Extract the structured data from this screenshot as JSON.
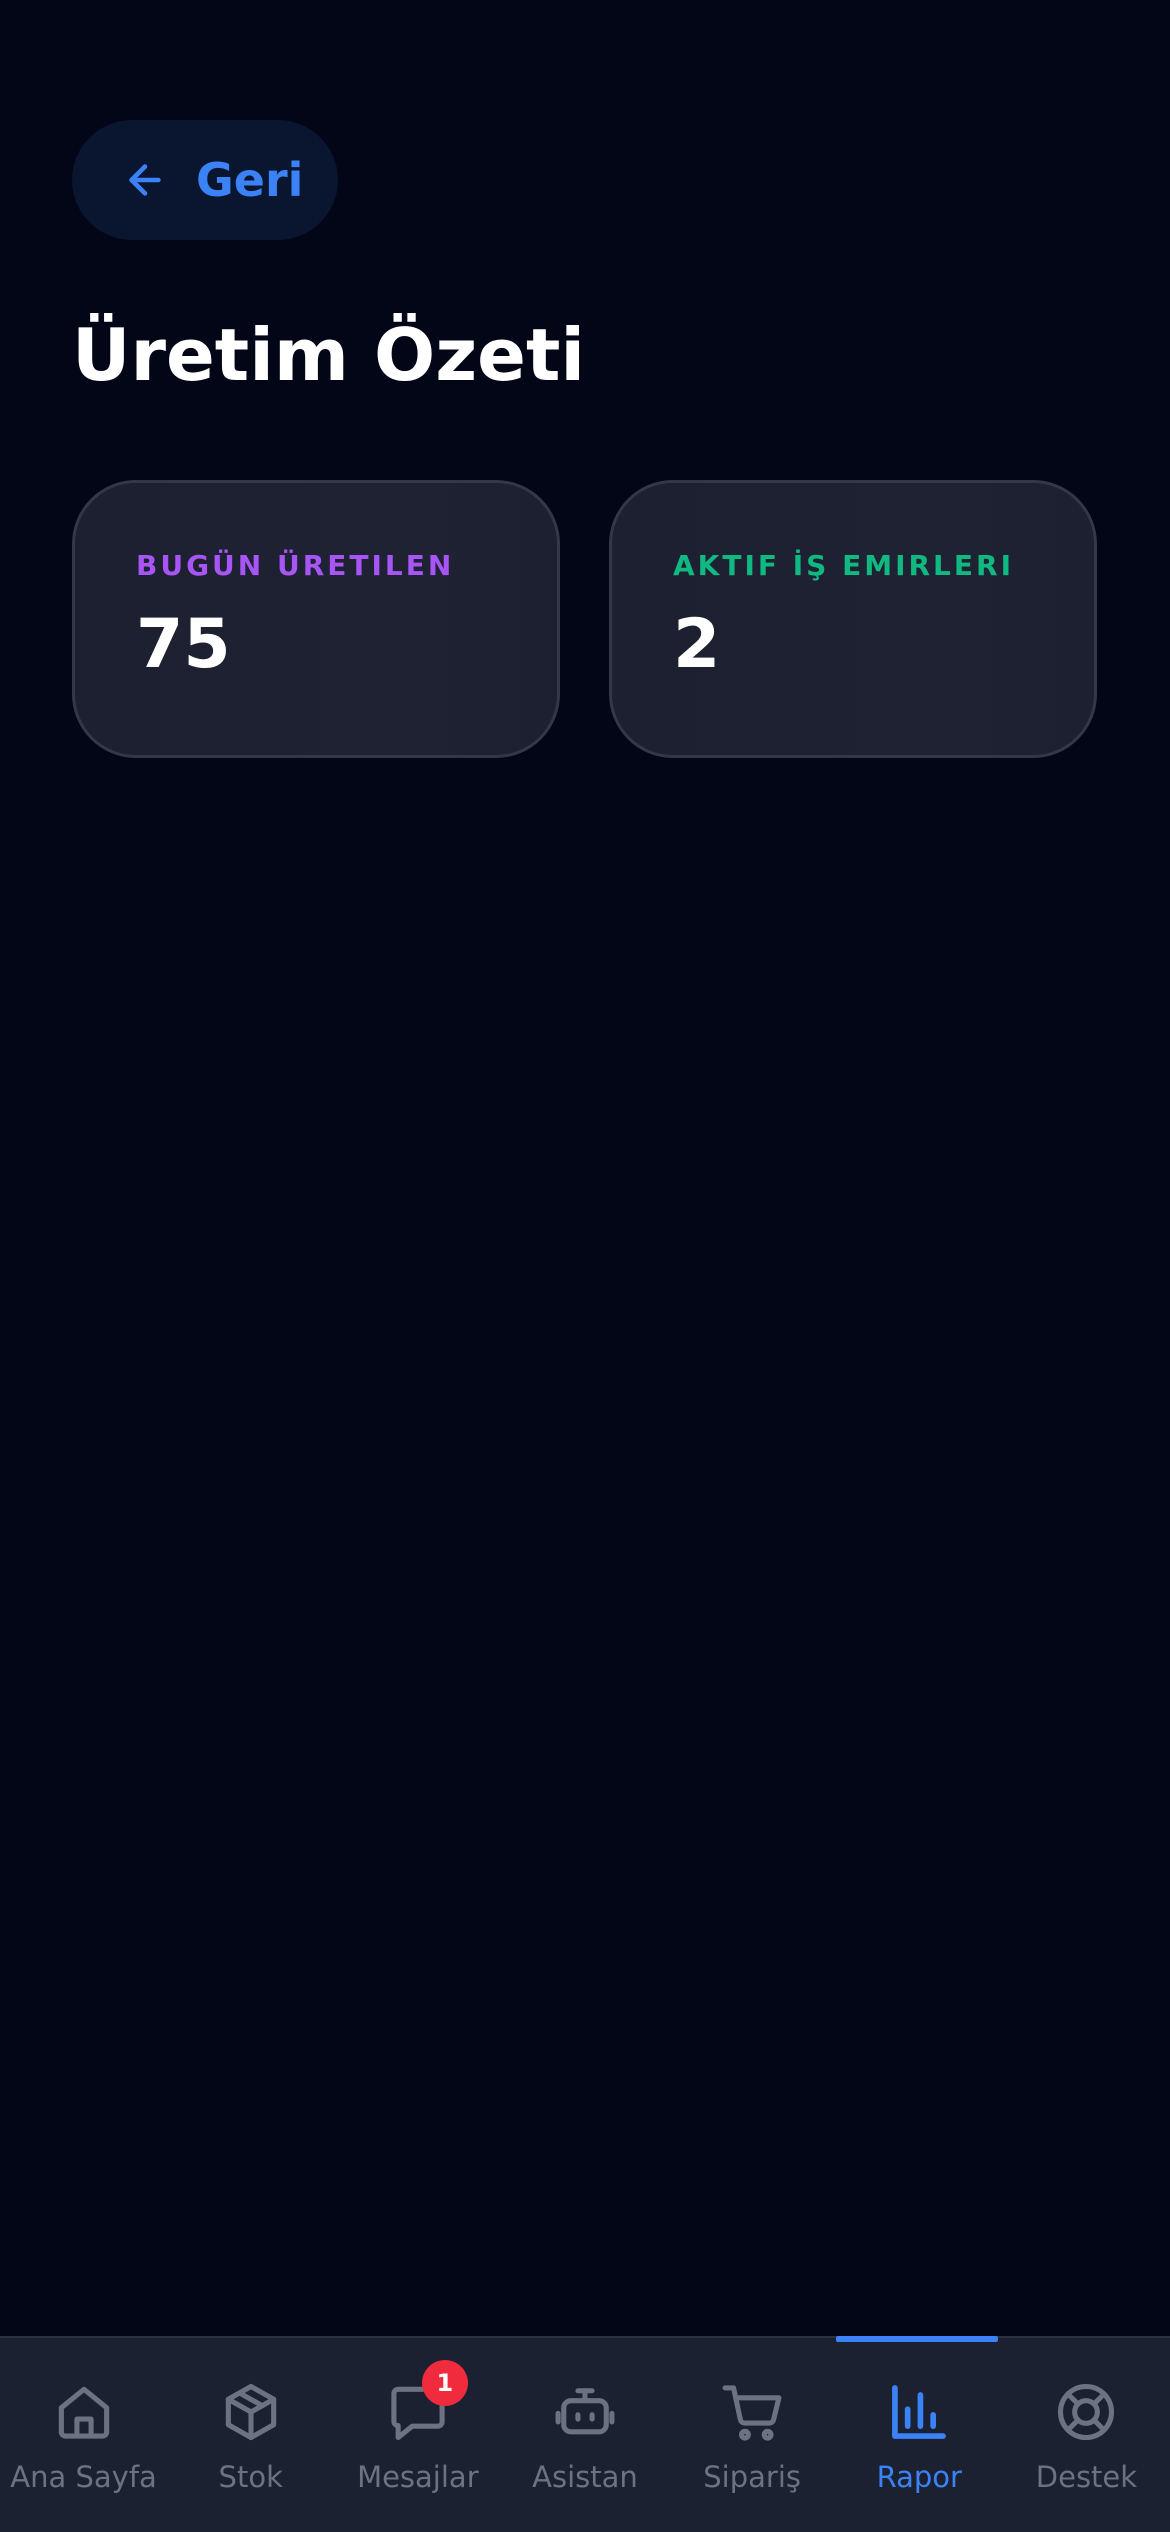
{
  "header": {
    "back_label": "Geri",
    "title": "Üretim Özeti"
  },
  "stats": [
    {
      "label": "BUGÜN ÜRETILEN",
      "value": "75",
      "color": "#a855f7"
    },
    {
      "label": "AKTIF İŞ EMIRLERI",
      "value": "2",
      "color": "#10b981"
    }
  ],
  "tab_bar": {
    "active_tab": "Rapor",
    "active_color": "#3b82f6",
    "inactive_color": "#6b7280",
    "tabs": [
      {
        "label": "Ana Sayfa",
        "icon": "home-icon"
      },
      {
        "label": "Stok",
        "icon": "box-icon"
      },
      {
        "label": "Mesajlar",
        "icon": "message-icon",
        "badge": "1"
      },
      {
        "label": "Asistan",
        "icon": "robot-icon"
      },
      {
        "label": "Sipariş",
        "icon": "cart-icon"
      },
      {
        "label": "Rapor",
        "icon": "bar-chart-icon"
      },
      {
        "label": "Destek",
        "icon": "lifebuoy-icon"
      }
    ]
  }
}
